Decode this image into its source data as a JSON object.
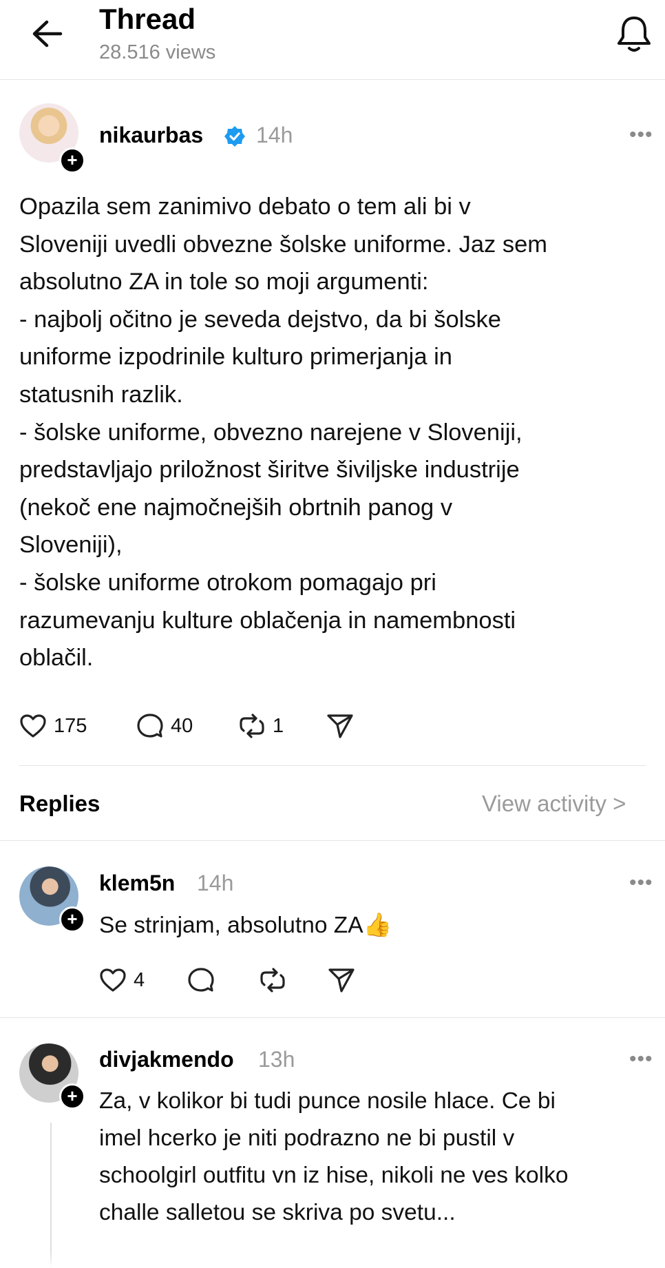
{
  "header": {
    "title": "Thread",
    "views": "28.516 views",
    "back_icon": "arrow-left-icon",
    "bell_icon": "bell-icon"
  },
  "post": {
    "username": "nikaurbas",
    "verified": true,
    "time": "14h",
    "lines": [
      "Opazila sem zanimivo debato o tem ali bi v",
      "Sloveniji uvedli obvezne šolske uniforme. Jaz sem",
      "absolutno ZA in tole so moji argumenti:",
      "- najbolj očitno je seveda dejstvo, da bi šolske",
      "uniforme izpodrinile kulturo primerjanja in",
      "statusnih razlik.",
      "- šolske uniforme, obvezno narejene v Sloveniji,",
      "predstavljajo priložnost širitve šiviljske industrije",
      "(nekoč ene najmočnejših obrtnih panog v",
      "Sloveniji),",
      "- šolske uniforme otrokom pomagajo pri",
      "razumevanju kulture oblačenja in namembnosti",
      "oblačil."
    ],
    "likes": "175",
    "comments": "40",
    "reposts": "1"
  },
  "replies_section": {
    "label": "Replies",
    "view_activity": "View activity >"
  },
  "replies": [
    {
      "username": "klem5n",
      "time": "14h",
      "lines": [
        "Se strinjam, absolutno ZA👍"
      ],
      "likes": "4"
    },
    {
      "username": "divjakmendo",
      "time": "13h",
      "lines": [
        "Za, v kolikor bi tudi punce nosile hlace. Ce bi",
        "imel hcerko je niti podrazno ne bi pustil v",
        "schoolgirl outfitu vn iz hise, nikoli ne ves kolko",
        "challe salletou se skriva po svetu..."
      ]
    }
  ],
  "colors": {
    "verified_blue": "#1d9bf0",
    "muted_text": "#9a9a9a",
    "divider": "#e4e4e4"
  }
}
